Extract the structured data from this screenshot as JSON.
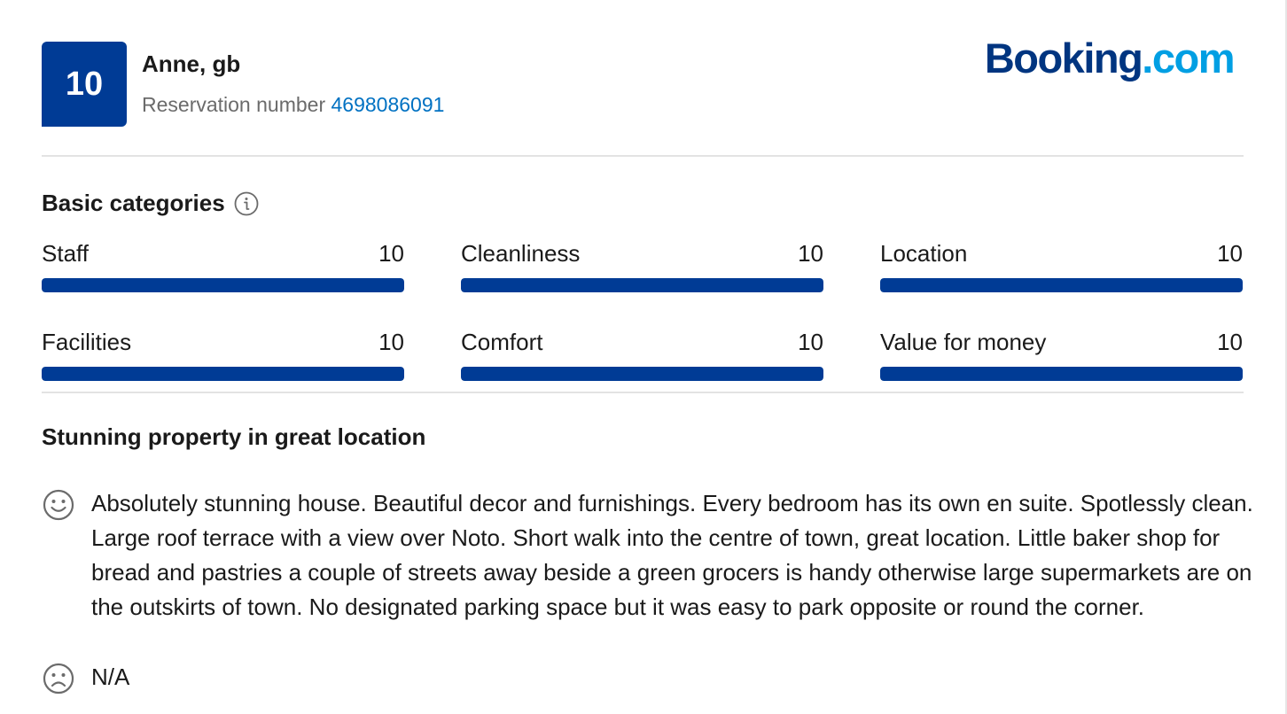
{
  "review": {
    "score": "10",
    "guest": "Anne, gb",
    "reservation_label": "Reservation number",
    "reservation_number": "4698086091",
    "title": "Stunning property in great location",
    "positive_text": "Absolutely stunning house. Beautiful decor and furnishings. Every bedroom has its own en suite. Spotlessly clean. Large roof terrace with a view over Noto. Short walk into the centre of town, great location. Little baker shop for bread and pastries a couple of streets away beside a green grocers is handy otherwise large supermarkets are on the outskirts of town. No designated parking space but it was easy to park opposite or round the corner.",
    "negative_text": "N/A"
  },
  "brand": {
    "name": "Booking",
    "suffix": ".com",
    "primary_color": "#003580",
    "accent_color": "#009fe3"
  },
  "basic_categories": {
    "title": "Basic categories",
    "info_icon": "info-icon",
    "max_score": 10,
    "bar_color": "#003b95",
    "items": [
      {
        "label": "Staff",
        "score": "10",
        "fraction": 1.0
      },
      {
        "label": "Cleanliness",
        "score": "10",
        "fraction": 1.0
      },
      {
        "label": "Location",
        "score": "10",
        "fraction": 1.0
      },
      {
        "label": "Facilities",
        "score": "10",
        "fraction": 1.0
      },
      {
        "label": "Comfort",
        "score": "10",
        "fraction": 1.0
      },
      {
        "label": "Value for money",
        "score": "10",
        "fraction": 1.0
      }
    ]
  },
  "icons": {
    "positive": "smiling-face-icon",
    "negative": "frowning-face-icon"
  }
}
